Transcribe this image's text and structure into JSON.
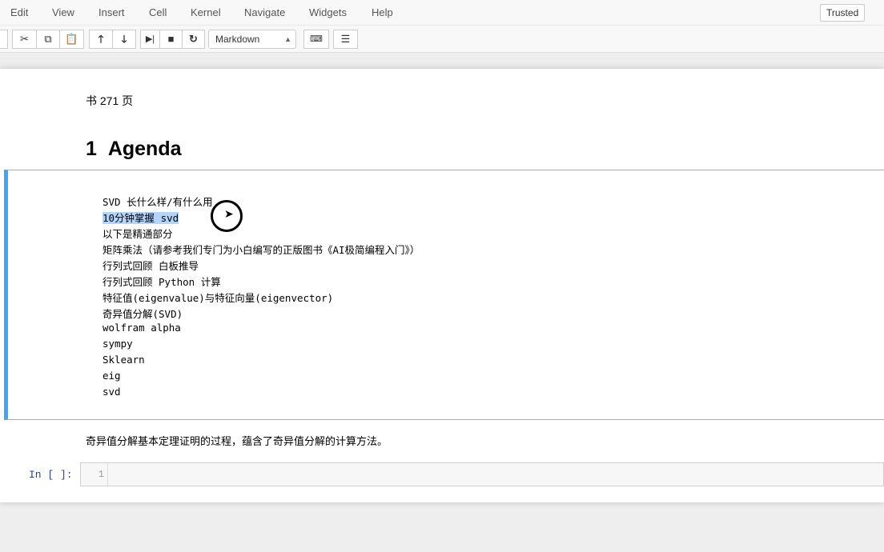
{
  "menu": [
    "Edit",
    "View",
    "Insert",
    "Cell",
    "Kernel",
    "Navigate",
    "Widgets",
    "Help"
  ],
  "trusted": "Trusted",
  "toolbar": {
    "cell_type": "Markdown"
  },
  "cells": {
    "note": "书 271 页",
    "heading_num": "1",
    "heading": "Agenda",
    "agenda": [
      "SVD 长什么样/有什么用",
      "10分钟掌握 svd",
      "以下是精通部分",
      "矩阵乘法（请参考我们专门为小白编写的正版图书《AI极简编程入门》）",
      "行列式回顾 白板推导",
      "行列式回顾 Python 计算",
      "特征值(eigenvalue)与特征向量(eigenvector)",
      "奇异值分解(SVD)",
      "wolfram alpha",
      "sympy",
      "Sklearn",
      "eig",
      "svd"
    ],
    "after": "奇异值分解基本定理证明的过程，蕴含了奇异值分解的计算方法。",
    "prompt": "In [ ]:",
    "line_no": "1"
  }
}
